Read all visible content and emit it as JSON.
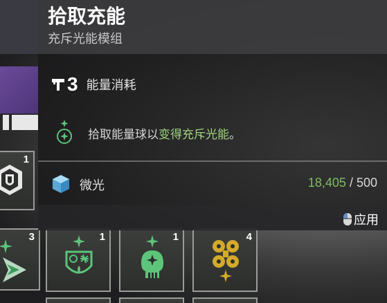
{
  "tooltip": {
    "title": "拾取充能",
    "subtitle": "充斥光能模组",
    "energy_cost": "3",
    "energy_label": "能量消耗",
    "perk_text_prefix": "拾取能量球以",
    "perk_text_highlight": "变得充斥光能",
    "perk_text_suffix": "。",
    "currency_label": "微光",
    "currency_have": "18,405",
    "currency_separator": " / ",
    "currency_cost": "500",
    "apply_label": "应用"
  },
  "slots": [
    {
      "count": "1",
      "icon": "armor-shield-icon"
    },
    {
      "count": "3",
      "icon": "arrow-mod-icon"
    },
    {
      "count": "1",
      "icon": "crest-mod-icon"
    },
    {
      "count": "1",
      "icon": "skull-mod-icon"
    },
    {
      "count": "4",
      "icon": "gold-pattern-mod-icon"
    }
  ],
  "colors": {
    "highlight_green": "#9fd27e",
    "glimmer_green": "#7fbe5e",
    "mod_green": "#5cc57a",
    "mod_gold": "#d4aa2a"
  }
}
